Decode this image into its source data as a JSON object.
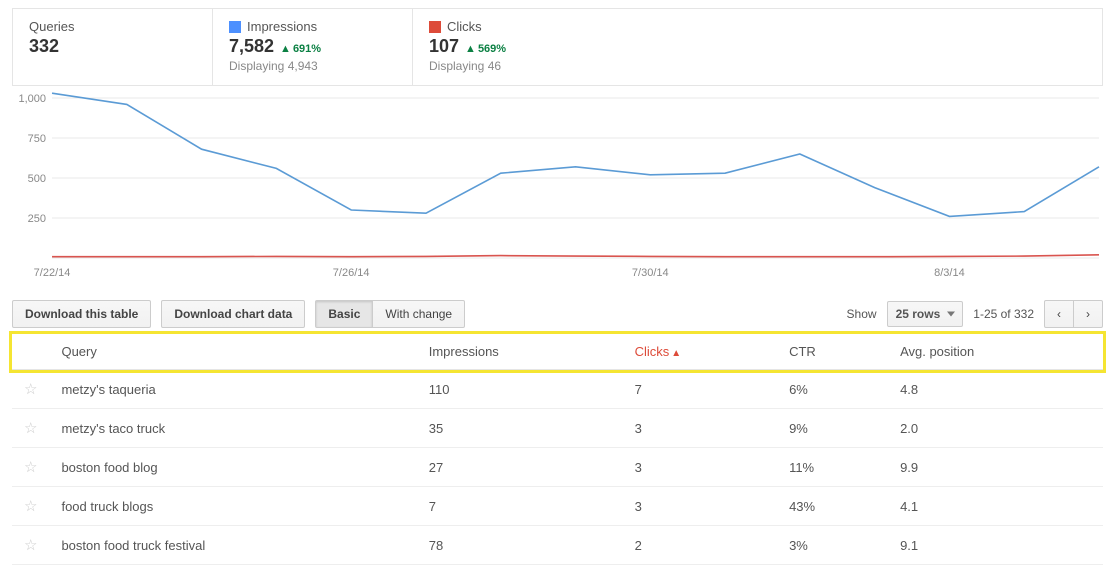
{
  "cards": {
    "queries": {
      "label": "Queries",
      "value": "332"
    },
    "impressions": {
      "label": "Impressions",
      "value": "7,582",
      "change": "691%",
      "sub": "Displaying 4,943"
    },
    "clicks": {
      "label": "Clicks",
      "value": "107",
      "change": "569%",
      "sub": "Displaying 46"
    }
  },
  "chart_data": {
    "type": "line",
    "x": [
      "7/22/14",
      "7/23/14",
      "7/24/14",
      "7/25/14",
      "7/26/14",
      "7/27/14",
      "7/28/14",
      "7/29/14",
      "7/30/14",
      "7/31/14",
      "8/1/14",
      "8/2/14",
      "8/3/14",
      "8/4/14",
      "8/5/14"
    ],
    "x_ticks": [
      "7/22/14",
      "7/26/14",
      "7/30/14",
      "8/3/14"
    ],
    "series": [
      {
        "name": "Impressions",
        "color": "#5b9bd5",
        "values": [
          1030,
          960,
          680,
          560,
          300,
          280,
          530,
          570,
          520,
          530,
          650,
          440,
          260,
          290,
          570
        ]
      },
      {
        "name": "Clicks",
        "color": "#d9544f",
        "values": [
          8,
          8,
          8,
          10,
          8,
          10,
          15,
          12,
          10,
          8,
          8,
          8,
          10,
          12,
          20
        ]
      }
    ],
    "ylabel": "",
    "xlabel": "",
    "ylim": [
      0,
      1000
    ],
    "y_ticks": [
      250,
      500,
      750,
      "1,000"
    ]
  },
  "toolbar": {
    "download_table": "Download this table",
    "download_chart": "Download chart data",
    "basic": "Basic",
    "withchange": "With change",
    "show_label": "Show",
    "rows_select": "25 rows",
    "range": "1-25 of 332"
  },
  "table": {
    "headers": {
      "query": "Query",
      "impressions": "Impressions",
      "clicks": "Clicks",
      "ctr": "CTR",
      "avg": "Avg. position"
    },
    "sort": "clicks",
    "rows": [
      {
        "query": "metzy's taqueria",
        "impressions": "110",
        "clicks": "7",
        "ctr": "6%",
        "avg": "4.8"
      },
      {
        "query": "metzy's taco truck",
        "impressions": "35",
        "clicks": "3",
        "ctr": "9%",
        "avg": "2.0"
      },
      {
        "query": "boston food blog",
        "impressions": "27",
        "clicks": "3",
        "ctr": "11%",
        "avg": "9.9"
      },
      {
        "query": "food truck blogs",
        "impressions": "7",
        "clicks": "3",
        "ctr": "43%",
        "avg": "4.1"
      },
      {
        "query": "boston food truck festival",
        "impressions": "78",
        "clicks": "2",
        "ctr": "3%",
        "avg": "9.1"
      }
    ]
  }
}
